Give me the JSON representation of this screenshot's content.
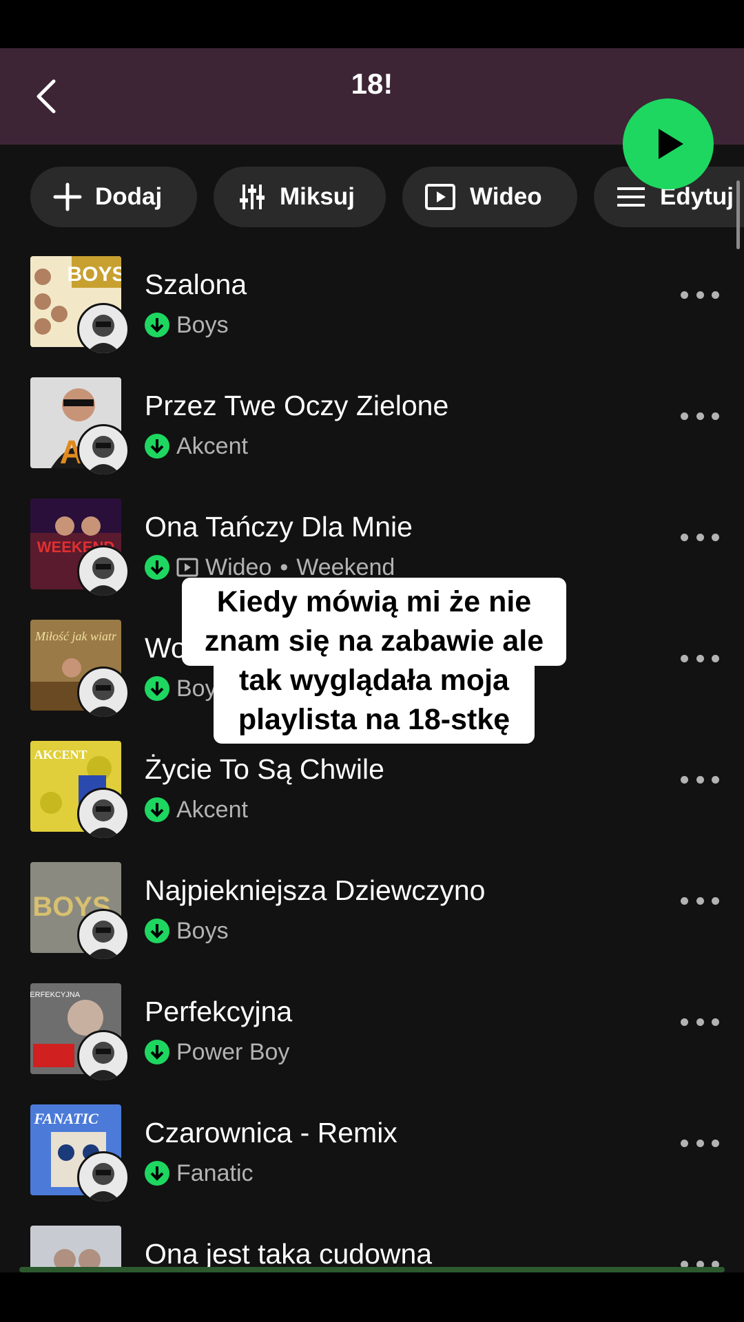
{
  "header": {
    "title": "18!"
  },
  "chips": [
    {
      "label": "Dodaj",
      "icon": "plus-icon"
    },
    {
      "label": "Miksuj",
      "icon": "mix-icon"
    },
    {
      "label": "Wideo",
      "icon": "video-icon"
    },
    {
      "label": "Edytuj",
      "icon": "list-icon"
    }
  ],
  "tracks": [
    {
      "title": "Szalona",
      "artist": "Boys",
      "cover_text": "BOYS",
      "cover_color": "#c8a030"
    },
    {
      "title": "Przez Twe Oczy Zielone",
      "artist": "Akcent",
      "cover_text": "A",
      "cover_color": "#d8d8d8"
    },
    {
      "title": "Ona Tańczy Dla Mnie",
      "video_label": "Wideo",
      "separator": "•",
      "artist": "Weekend",
      "cover_text": "WEEKEND",
      "cover_color": "#5a1b2e"
    },
    {
      "title": "Wo",
      "artist": "Boy",
      "cover_text": "Miłość jak wiatr",
      "cover_color": "#8a6a3a"
    },
    {
      "title": "Życie To Są Chwile",
      "artist": "Akcent",
      "cover_text": "AKCENT",
      "cover_color": "#d8c830"
    },
    {
      "title": "Najpiekniejsza Dziewczyno",
      "artist": "Boys",
      "cover_text": "BOYS",
      "cover_color": "#8a8a80"
    },
    {
      "title": "Perfekcyjna",
      "artist": "Power Boy",
      "cover_text": "PERFEKCYJNA",
      "cover_color": "#7a7a7a"
    },
    {
      "title": "Czarownica - Remix",
      "artist": "Fanatic",
      "cover_text": "FANATIC",
      "cover_color": "#4b7ad8"
    },
    {
      "title": "Ona jest taka cudowna",
      "cover_color": "#c8ccd2"
    }
  ],
  "caption": {
    "line1": "Kiedy mówią mi że nie",
    "line2": "znam się na zabawie ale",
    "line3": "tak wyglądała moja",
    "line4": "playlista na 18-stkę"
  },
  "colors": {
    "accent": "#1ed760",
    "header_bg": "#3d2536",
    "background": "#121212"
  }
}
